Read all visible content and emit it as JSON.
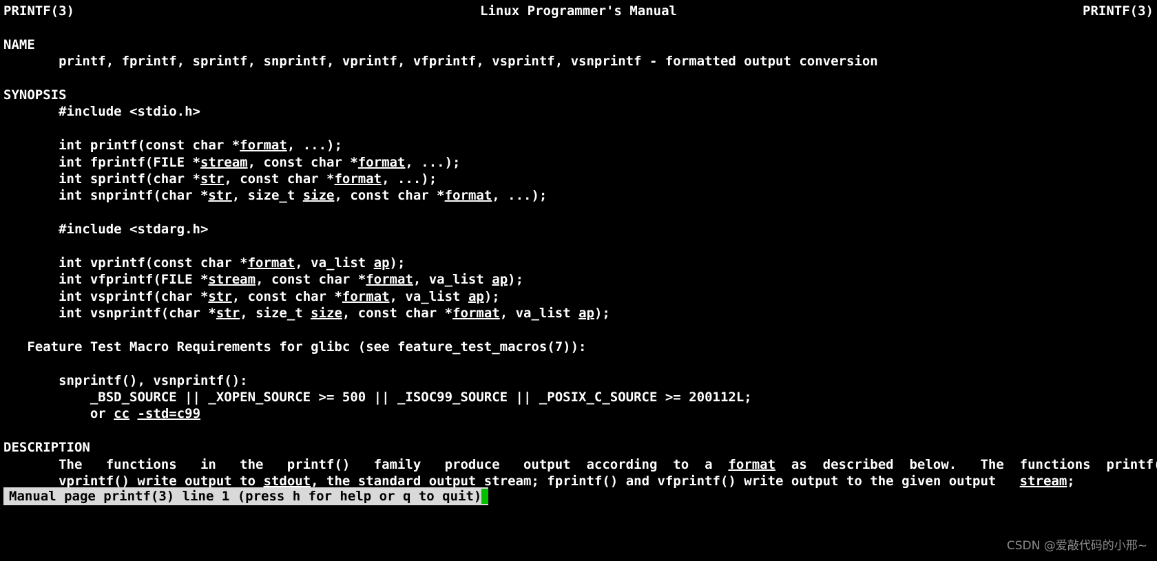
{
  "terminal": {
    "background": "#000000",
    "foreground": "#ffffff",
    "program": "less",
    "manpage": "printf(3)"
  },
  "header": {
    "left": "PRINTF(3)",
    "center": "Linux Programmer's Manual",
    "right": "PRINTF(3)"
  },
  "sections": {
    "name": {
      "heading": "NAME",
      "body": "       printf, fprintf, sprintf, snprintf, vprintf, vfprintf, vsprintf, vsnprintf - formatted output conversion"
    },
    "synopsis": {
      "heading": "SYNOPSIS",
      "include_stdio": "       #include <stdio.h>",
      "include_stdarg": "       #include <stdarg.h>",
      "protos_stdio": [
        {
          "pre": "       int printf(const char *",
          "arg1": "format",
          "mid": ", ...);",
          "arg2": "",
          "post": ""
        },
        {
          "pre": "       int fprintf(FILE *",
          "arg1": "stream",
          "mid": ", const char *",
          "arg2": "format",
          "post": ", ...);"
        },
        {
          "pre": "       int sprintf(char *",
          "arg1": "str",
          "mid": ", const char *",
          "arg2": "format",
          "post": ", ...);"
        },
        {
          "pre": "       int snprintf(char *",
          "arg1": "str",
          "mid": ", size_t ",
          "arg2": "size",
          "post": ", const char *",
          "arg3": "format",
          "tail": ", ...);"
        }
      ],
      "protos_stdarg": [
        {
          "pre": "       int vprintf(const char *",
          "arg1": "format",
          "mid": ", va_list ",
          "arg2": "ap",
          "post": ");"
        },
        {
          "pre": "       int vfprintf(FILE *",
          "arg1": "stream",
          "mid": ", const char *",
          "arg2": "format",
          "post": ", va_list ",
          "arg3": "ap",
          "tail": ");"
        },
        {
          "pre": "       int vsprintf(char *",
          "arg1": "str",
          "mid": ", const char *",
          "arg2": "format",
          "post": ", va_list ",
          "arg3": "ap",
          "tail": ");"
        },
        {
          "pre": "       int vsnprintf(char *",
          "arg1": "str",
          "mid": ", size_t ",
          "arg2": "size",
          "post": ", const char *",
          "arg3": "format",
          "tail": ", va_list ",
          "arg4": "ap",
          "tail2": ");"
        }
      ],
      "feature_test_heading": "   Feature Test Macro Requirements for glibc (see feature_test_macros(7)):",
      "feature_funcs": "       snprintf(), vsnprintf():",
      "feature_macros": "           _BSD_SOURCE || _XOPEN_SOURCE >= 500 || _ISOC99_SOURCE || _POSIX_C_SOURCE >= 200112L;",
      "feature_or_pre": "           or ",
      "feature_or_cc": "cc",
      "feature_or_sep": " ",
      "feature_or_flag": "-std=c99"
    },
    "description": {
      "heading": "DESCRIPTION",
      "line1_a": "       The   functions   in   the   printf()   family   produce   output  according  to  a  ",
      "line1_format": "format",
      "line1_b": "  as  described  below.   The  functions  printf()  and",
      "line2_a": "       vprintf() write output to ",
      "line2_stdout": "stdout",
      "line2_b": ", the standard output stream; fprintf() and vfprintf() write output to the given output   ",
      "line2_stream": "stream",
      "line2_c": ";"
    }
  },
  "statusbar": {
    "text": "Manual page printf(3) line 1 (press h for help or q to quit)",
    "cursor_color": "#00c000",
    "background": "#d9d9d9",
    "foreground": "#000000"
  },
  "watermark": {
    "text": "CSDN @爱敲代码的小邢~",
    "color": "#8d8d8d"
  }
}
